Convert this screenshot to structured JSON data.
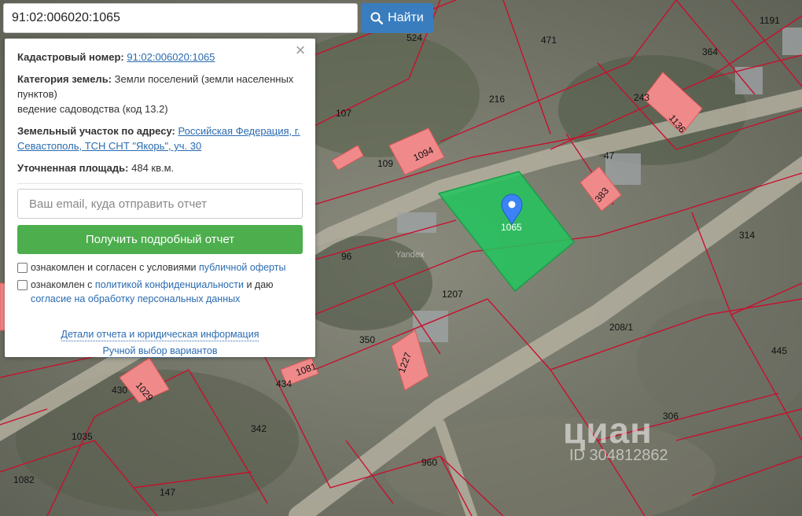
{
  "search": {
    "value": "91:02:006020:1065",
    "button_label": "Найти"
  },
  "panel": {
    "cadastral_label": "Кадастровый номер:",
    "cadastral_value": "91:02:006020:1065",
    "category_label": "Категория земель:",
    "category_value": "Земли поселений (земли населенных пунктов)",
    "category_line2": "ведение садоводства (код 13.2)",
    "address_label": "Земельный участок по адресу:",
    "address_value": "Российская Федерация, г. Севастополь, ТСН СНТ \"Якорь\", уч. 30",
    "area_label": "Уточненная площадь:",
    "area_value": "484 кв.м.",
    "email_placeholder": "Ваш email, куда отправить отчет",
    "report_button": "Получить подробный отчет",
    "check1_text": "ознакомлен и согласен с условиями",
    "check1_link": "публичной оферты",
    "check2_text_a": "ознакомлен с",
    "check2_link1": "политикой конфиденциальности",
    "check2_text_b": "и даю",
    "check2_link2": "согласие на обработку персональных данных",
    "details_link": "Детали отчета и юридическая информация",
    "manual_link": "Ручной выбор вариантов",
    "close_icon": "close-icon"
  },
  "map": {
    "selected_parcel": "1065",
    "map_provider": "Yandex",
    "parcel_labels": [
      "524",
      "471",
      "1191",
      "364",
      "107",
      "216",
      "243",
      "1136",
      "109",
      "1094",
      "47",
      "383",
      "96",
      "314",
      "1207",
      "208/1",
      "350",
      "445",
      "1081",
      "1227",
      "430",
      "1029",
      "434",
      "342",
      "306",
      "1035",
      "960",
      "1082",
      "147"
    ],
    "colors": {
      "parcel_line": "#c8102e",
      "building": "#f08a8a",
      "selected": "#22c55e",
      "marker": "#3b82f6"
    }
  },
  "watermark": {
    "brand": "циан",
    "id": "ID 304812862"
  }
}
